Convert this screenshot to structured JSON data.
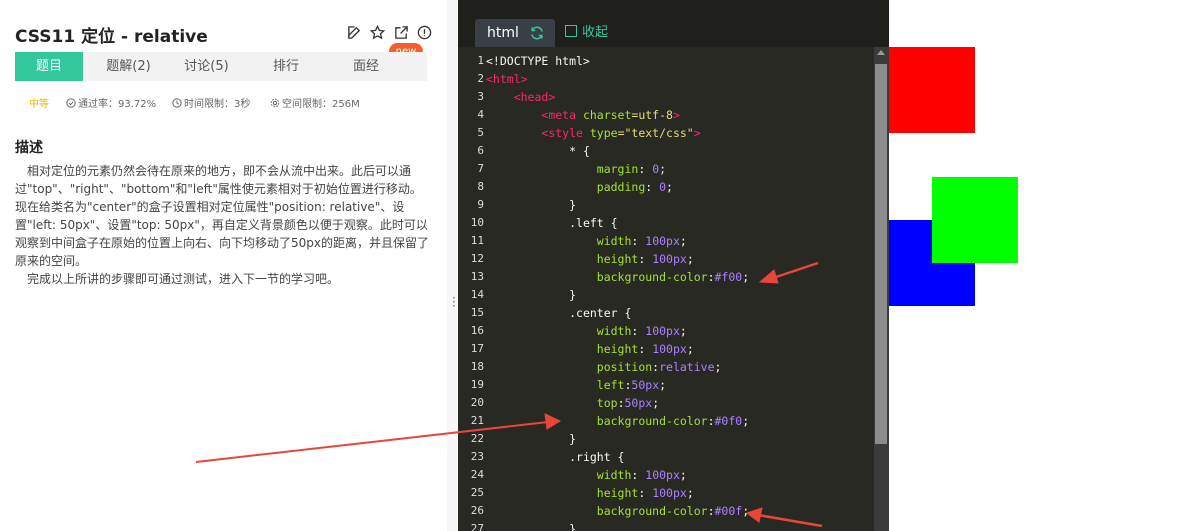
{
  "problem": {
    "title": "CSS11  定位 - relative",
    "new_badge": "new",
    "tabs": [
      {
        "label": "题目",
        "active": true
      },
      {
        "label": "题解(2)",
        "active": false
      },
      {
        "label": "讨论(5)",
        "active": false
      },
      {
        "label": "排行",
        "active": false
      },
      {
        "label": "面经",
        "active": false
      }
    ],
    "difficulty": "中等",
    "pass_rate": "通过率：93.72%",
    "time_limit": "时间限制：3秒",
    "memory_limit": "空间限制：256M",
    "description_heading": "描述",
    "description_p1": "相对定位的元素仍然会待在原来的地方，即不会从流中出来。此后可以通过\"top\"、\"right\"、\"bottom\"和\"left\"属性使元素相对于初始位置进行移动。现在给类名为\"center\"的盒子设置相对定位属性\"position: relative\"、设置\"left: 50px\"、设置\"top: 50px\"，再自定义背景颜色以便于观察。此时可以观察到中间盒子在原始的位置上向右、向下均移动了50px的距离，并且保留了原来的空间。",
    "description_p2": "完成以上所讲的步骤即可通过测试，进入下一节的学习吧。"
  },
  "editor": {
    "tab_label": "html",
    "collapse_label": "收起",
    "line_numbers": [
      "1",
      "2",
      "3",
      "4",
      "5",
      "6",
      "7",
      "8",
      "9",
      "10",
      "11",
      "12",
      "13",
      "14",
      "15",
      "16",
      "17",
      "18",
      "19",
      "20",
      "21",
      "22",
      "23",
      "24",
      "25",
      "26",
      "27"
    ],
    "code": {
      "l1": "<!DOCTYPE html>",
      "l2": "<html>",
      "l3": "<head>",
      "l4_tag": "<meta ",
      "l4_attr": "charset",
      "l4_val": "=utf-8",
      "l4_end": ">",
      "l5_tag": "<style ",
      "l5_attr": "type",
      "l5_val": "=\"text/css\"",
      "l5_end": ">",
      "l6": "* {",
      "l7_prop": "margin",
      "l7_val": "0",
      "l8_prop": "padding",
      "l8_val": "0",
      "l9": "}",
      "l10": ".left {",
      "l11_prop": "width",
      "l11_val": "100px",
      "l12_prop": "height",
      "l12_val": "100px",
      "l13_prop": "background-color",
      "l13_val": "#f00",
      "l14": "}",
      "l15": ".center {",
      "l16_prop": "width",
      "l16_val": "100px",
      "l17_prop": "height",
      "l17_val": "100px",
      "l18_prop": "position",
      "l18_val": "relative",
      "l19_prop": "left",
      "l19_val": "50px",
      "l20_prop": "top",
      "l20_val": "50px",
      "l21_prop": "background-color",
      "l21_val": "#0f0",
      "l22": "}",
      "l23": ".right {",
      "l24_prop": "width",
      "l24_val": "100px",
      "l25_prop": "height",
      "l25_val": "100px",
      "l26_prop": "background-color",
      "l26_val": "#00f",
      "l27": "}"
    }
  },
  "preview": {
    "left_color": "#ff0000",
    "center_color": "#00ff00",
    "right_color": "#0000ff"
  },
  "colors": {
    "accent": "#32c89b",
    "badge": "#f4602a",
    "annotation_arrow": "#e8453c"
  }
}
